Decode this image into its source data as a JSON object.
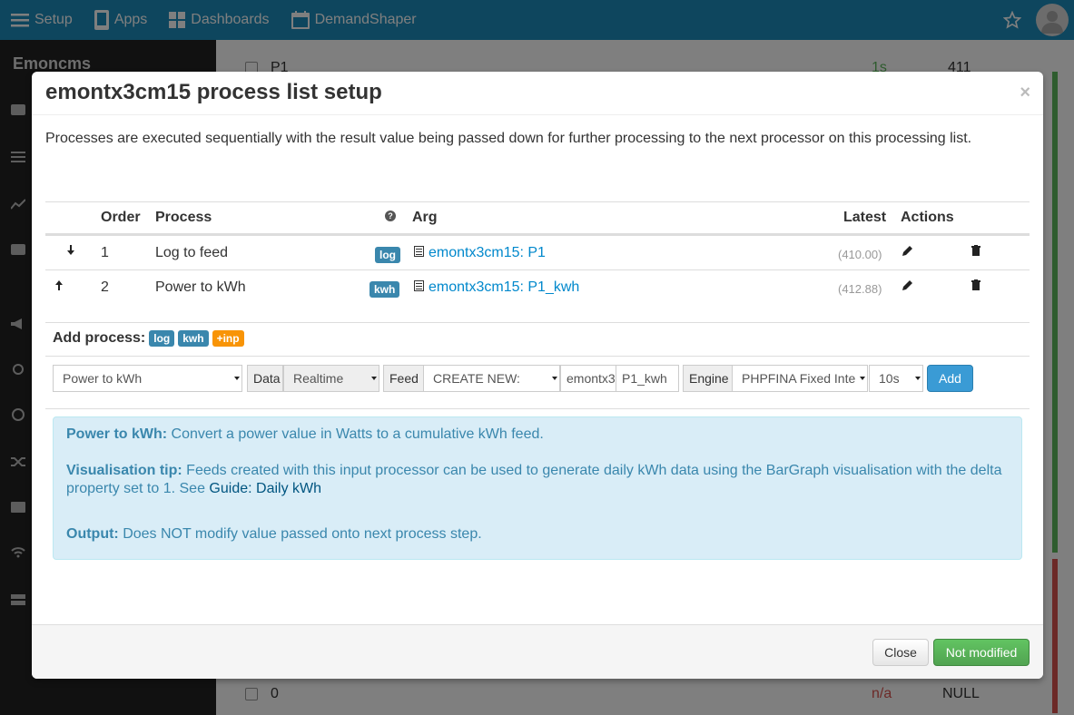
{
  "nav": {
    "setup": "Setup",
    "apps": "Apps",
    "dashboards": "Dashboards",
    "demandshaper": "DemandShaper"
  },
  "sidebar": {
    "brand": "Emoncms"
  },
  "background": {
    "row1_name": "P1",
    "row1_time": "1s",
    "row1_value": "411",
    "row2_name": "0",
    "row2_time": "n/a",
    "row2_value": "NULL"
  },
  "modal": {
    "title": "emontx3cm15 process list setup",
    "close_symbol": "×",
    "intro": "Processes are executed sequentially with the result value being passed down for further processing to the next processor on this processing list.",
    "table": {
      "headers": {
        "order": "Order",
        "process": "Process",
        "help": "?",
        "arg": "Arg",
        "latest": "Latest",
        "actions": "Actions"
      },
      "rows": [
        {
          "order": "1",
          "process": "Log to feed",
          "badge": "log",
          "arg": "emontx3cm15: P1",
          "latest": "(410.00)",
          "move": "down"
        },
        {
          "order": "2",
          "process": "Power to kWh",
          "badge": "kwh",
          "arg": "emontx3cm15: P1_kwh",
          "latest": "(412.88)",
          "move": "up"
        }
      ]
    },
    "add_process": {
      "label": "Add process:",
      "badges": [
        "log",
        "kwh",
        "+inp"
      ],
      "process_select": "Power to kWh",
      "data_label": "Data",
      "data_select": "Realtime",
      "feed_label": "Feed",
      "feed_select": "CREATE NEW:",
      "feed_tag": "emontx3",
      "feed_name": "P1_kwh",
      "engine_label": "Engine",
      "engine_select": "PHPFINA Fixed Inte",
      "interval_select": "10s",
      "add_button": "Add"
    },
    "info": {
      "title_bold": "Power to kWh:",
      "title_text": " Convert a power value in Watts to a cumulative kWh feed.",
      "tip_bold": "Visualisation tip:",
      "tip_text": " Feeds created with this input processor can be used to generate daily kWh data using the BarGraph visualisation with the delta property set to 1. See ",
      "tip_link": "Guide: Daily kWh",
      "output_bold": "Output:",
      "output_text": " Does NOT modify value passed onto next process step."
    },
    "footer": {
      "close": "Close",
      "status": "Not modified"
    }
  },
  "colors": {
    "topbar": "#1d8dbc",
    "info_bg": "#d9edf7",
    "label_info": "#3a87ad",
    "label_warning": "#f89406",
    "success": "#51a351"
  }
}
